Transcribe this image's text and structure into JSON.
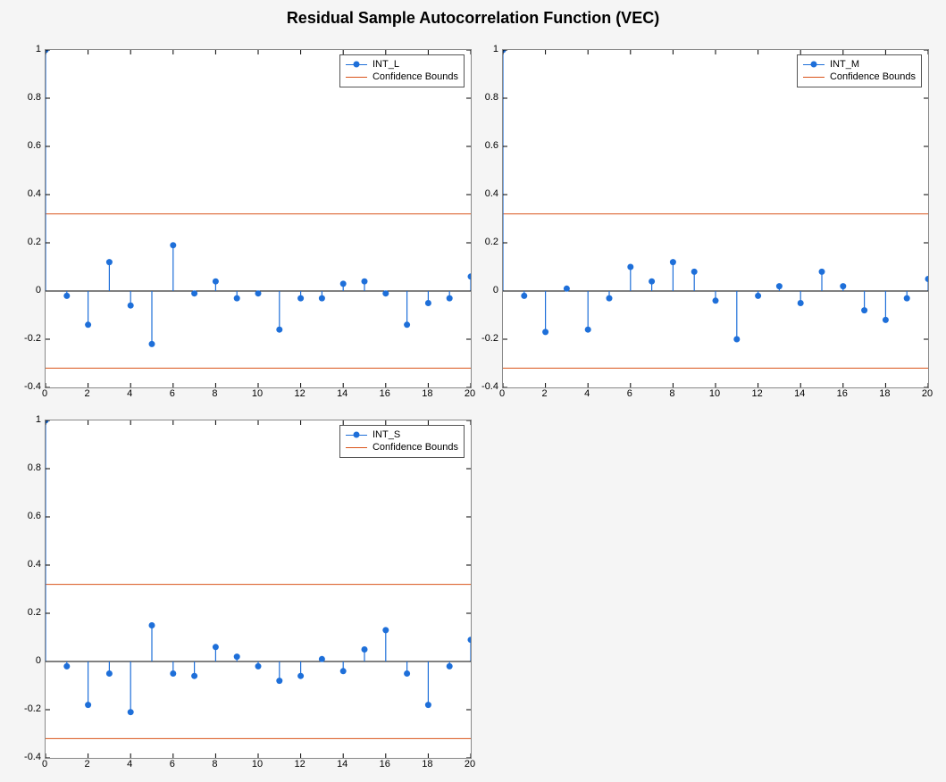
{
  "title": "Residual Sample Autocorrelation Function (VEC)",
  "legend": {
    "series_line": "Confidence Bounds"
  },
  "colors": {
    "series": "#1e6fd9",
    "bounds": "#d95319",
    "axis": "#000",
    "bg_plot": "#fff",
    "bg_figure": "#f5f5f5"
  },
  "chart_data": [
    {
      "type": "stem",
      "series_name": "INT_L",
      "xlim": [
        0,
        20
      ],
      "ylim": [
        -0.4,
        1.0
      ],
      "xticks": [
        0,
        2,
        4,
        6,
        8,
        10,
        12,
        14,
        16,
        18,
        20
      ],
      "yticks": [
        -0.4,
        -0.2,
        0,
        0.2,
        0.4,
        0.6,
        0.8,
        1.0
      ],
      "bounds": [
        0.32,
        -0.32
      ],
      "lags": [
        0,
        1,
        2,
        3,
        4,
        5,
        6,
        7,
        8,
        9,
        10,
        11,
        12,
        13,
        14,
        15,
        16,
        17,
        18,
        19,
        20
      ],
      "values": [
        1.0,
        -0.02,
        -0.14,
        0.12,
        -0.06,
        -0.22,
        0.19,
        -0.01,
        0.04,
        -0.03,
        -0.01,
        -0.16,
        -0.03,
        -0.03,
        0.03,
        0.04,
        -0.01,
        -0.14,
        -0.05,
        -0.03,
        0.06
      ]
    },
    {
      "type": "stem",
      "series_name": "INT_M",
      "xlim": [
        0,
        20
      ],
      "ylim": [
        -0.4,
        1.0
      ],
      "xticks": [
        0,
        2,
        4,
        6,
        8,
        10,
        12,
        14,
        16,
        18,
        20
      ],
      "yticks": [
        -0.4,
        -0.2,
        0,
        0.2,
        0.4,
        0.6,
        0.8,
        1.0
      ],
      "bounds": [
        0.32,
        -0.32
      ],
      "lags": [
        0,
        1,
        2,
        3,
        4,
        5,
        6,
        7,
        8,
        9,
        10,
        11,
        12,
        13,
        14,
        15,
        16,
        17,
        18,
        19,
        20
      ],
      "values": [
        1.0,
        -0.02,
        -0.17,
        0.01,
        -0.16,
        -0.03,
        0.1,
        0.04,
        0.12,
        0.08,
        -0.04,
        -0.2,
        -0.02,
        0.02,
        -0.05,
        0.08,
        0.02,
        -0.08,
        -0.12,
        -0.03,
        0.05
      ]
    },
    {
      "type": "stem",
      "series_name": "INT_S",
      "xlim": [
        0,
        20
      ],
      "ylim": [
        -0.4,
        1.0
      ],
      "xticks": [
        0,
        2,
        4,
        6,
        8,
        10,
        12,
        14,
        16,
        18,
        20
      ],
      "yticks": [
        -0.4,
        -0.2,
        0,
        0.2,
        0.4,
        0.6,
        0.8,
        1.0
      ],
      "bounds": [
        0.32,
        -0.32
      ],
      "lags": [
        0,
        1,
        2,
        3,
        4,
        5,
        6,
        7,
        8,
        9,
        10,
        11,
        12,
        13,
        14,
        15,
        16,
        17,
        18,
        19,
        20
      ],
      "values": [
        1.0,
        -0.02,
        -0.18,
        -0.05,
        -0.21,
        0.15,
        -0.05,
        -0.06,
        0.06,
        0.02,
        -0.02,
        -0.08,
        -0.06,
        0.01,
        -0.04,
        0.05,
        0.13,
        -0.05,
        -0.18,
        -0.02,
        0.09
      ]
    }
  ]
}
